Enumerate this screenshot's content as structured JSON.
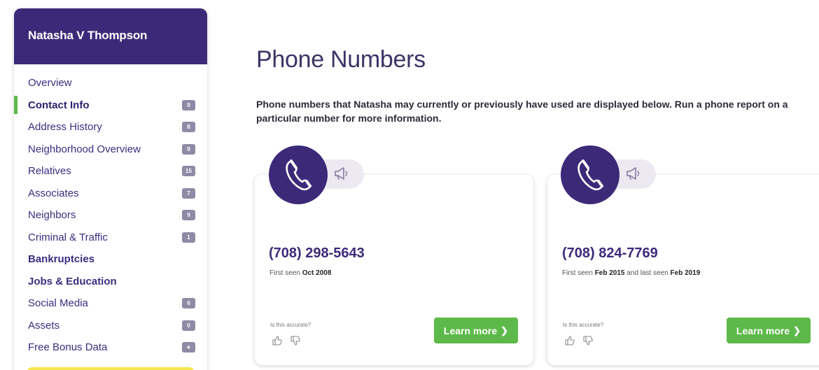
{
  "sidebar": {
    "person_name": "Natasha V Thompson",
    "items": [
      {
        "label": "Overview",
        "badge": null,
        "active": false
      },
      {
        "label": "Contact Info",
        "badge": "9",
        "active": true
      },
      {
        "label": "Address History",
        "badge": "8",
        "active": false
      },
      {
        "label": "Neighborhood Overview",
        "badge": "9",
        "active": false
      },
      {
        "label": "Relatives",
        "badge": "15",
        "active": false
      },
      {
        "label": "Associates",
        "badge": "7",
        "active": false
      },
      {
        "label": "Neighbors",
        "badge": "9",
        "active": false
      },
      {
        "label": "Criminal & Traffic",
        "badge": "1",
        "active": false
      },
      {
        "label": "Bankruptcies",
        "badge": null,
        "active": false
      },
      {
        "label": "Jobs & Education",
        "badge": null,
        "active": false
      },
      {
        "label": "Social Media",
        "badge": "6",
        "active": false
      },
      {
        "label": "Assets",
        "badge": "0",
        "active": false
      },
      {
        "label": "Free Bonus Data",
        "badge": "★",
        "active": false
      }
    ]
  },
  "main": {
    "title": "Phone Numbers",
    "intro": "Phone numbers that Natasha may currently or previously have used are displayed below. Run a phone report on a particular number for more information.",
    "cards": [
      {
        "number": "(708) 298-5643",
        "first_seen_prefix": "First seen ",
        "first_seen": "Oct 2008",
        "last_seen_prefix": "",
        "last_seen": "",
        "accuracy_prompt": "Is this accurate?",
        "button_label": "Learn more",
        "button_chevron": "❯"
      },
      {
        "number": "(708) 824-7769",
        "first_seen_prefix": "First seen ",
        "first_seen": "Feb 2015",
        "last_seen_prefix": " and last seen ",
        "last_seen": "Feb 2019",
        "accuracy_prompt": "Is this accurate?",
        "button_label": "Learn more",
        "button_chevron": "❯"
      }
    ]
  },
  "icons": {
    "card_primary": "phone-icon",
    "card_secondary": "megaphone-icon",
    "feedback": [
      "thumbs-up-icon",
      "thumbs-down-icon"
    ]
  },
  "colors": {
    "brand_purple": "#3c2a79",
    "accent_green": "#5db94a",
    "badge_gray": "#8f8aa6",
    "cta_yellow": "#f4e64a"
  }
}
